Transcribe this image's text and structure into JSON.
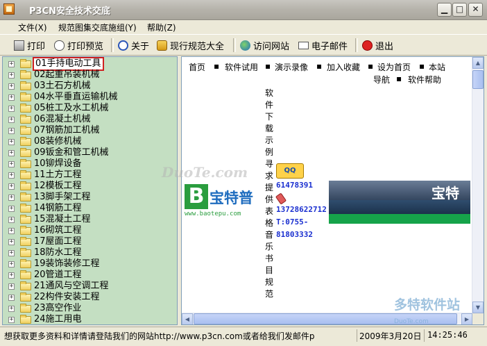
{
  "window": {
    "title": "P3CN安全技术交底",
    "minimize": "▁",
    "maximize": "□",
    "close": "✕"
  },
  "menu": [
    {
      "label": "文件(X)"
    },
    {
      "label": "规范图集交底施组(Y)"
    },
    {
      "label": "帮助(Z)"
    }
  ],
  "toolbar": [
    {
      "label": "打印",
      "icon": "printer-icon"
    },
    {
      "label": "打印预览",
      "icon": "print-preview-icon"
    },
    {
      "label": "关于",
      "icon": "info-icon"
    },
    {
      "label": "现行规范大全",
      "icon": "books-icon"
    },
    {
      "label": "访问网站",
      "icon": "globe-icon"
    },
    {
      "label": "电子邮件",
      "icon": "mail-icon"
    },
    {
      "label": "退出",
      "icon": "exit-icon"
    }
  ],
  "tree": {
    "selected_index": 0,
    "items": [
      "01手持电动工具",
      "02起重吊装机械",
      "03土石方机械",
      "04水平垂直运输机械",
      "05桩工及水工机械",
      "06混凝土机械",
      "07钢筋加工机械",
      "08装修机械",
      "09钣金和管工机械",
      "10铆焊设备",
      "11土方工程",
      "12模板工程",
      "13脚手架工程",
      "14钢筋工程",
      "15混凝土工程",
      "16砌筑工程",
      "17屋面工程",
      "18防水工程",
      "19装饰装修工程",
      "20管道工程",
      "21通风与空调工程",
      "22构件安装工程",
      "23高空作业",
      "24施工用电"
    ]
  },
  "web": {
    "nav": [
      "首页",
      "软件试用",
      "演示录像",
      "加入收藏",
      "设为首页",
      "本站",
      "导航",
      "软件帮助"
    ],
    "vertical_text": "软件下载示例寻求提供表格音乐书目规范",
    "qq_label": "QQ",
    "qq_number": "61478391",
    "mobile": "13728622712",
    "tel_prefix": "T:0755-",
    "tel_number": "81803332",
    "logo_letter": "B",
    "logo_name": "宝特普",
    "logo_url": "www.baotepu.com",
    "banner_text": "宝特"
  },
  "watermarks": {
    "center": "DuoTe.com",
    "corner": "多特软件站",
    "corner_sub": "DuoTe.com"
  },
  "status": {
    "message": "想获取更多资料和详情请登陆我们的网站http://www.p3cn.com或者给我们发邮件p",
    "date": "2009年3月20日",
    "time": "14:25:46"
  }
}
